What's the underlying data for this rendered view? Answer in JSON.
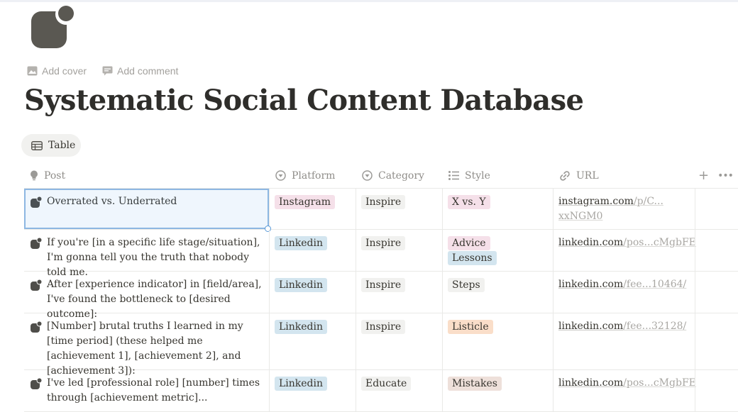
{
  "page": {
    "icon": "app-blob-icon",
    "add_cover": "Add cover",
    "add_comment": "Add comment",
    "title": "Systematic Social Content Database"
  },
  "view": {
    "label": "Table",
    "icon": "table-icon"
  },
  "columns": [
    {
      "label": "Post",
      "icon": "lightbulb-icon"
    },
    {
      "label": "Platform",
      "icon": "select-icon"
    },
    {
      "label": "Category",
      "icon": "select-icon"
    },
    {
      "label": "Style",
      "icon": "list-icon"
    },
    {
      "label": "URL",
      "icon": "link-icon"
    }
  ],
  "colors": {
    "pink_tag": "#f5e0e9",
    "blue_tag": "#d3e5ef",
    "gray_tag": "#f1f1ef",
    "orange_tag": "#fadec9",
    "brown_tag": "#eee0da"
  },
  "rows": [
    {
      "post": "Overrated vs. Underrated",
      "platform": "Instagram",
      "category": "Inspire",
      "styles": [
        "X vs. Y"
      ],
      "url_domain": "instagram.com",
      "url_rest": "/p/C...",
      "url_rest2": "xxNGM0"
    },
    {
      "post": "If you're [in a specific life stage/situation], I'm gonna tell you the truth that nobody told me.",
      "platform": "Linkedin",
      "category": "Inspire",
      "styles": [
        "Advice",
        "Lessons"
      ],
      "url_domain": "linkedin.com",
      "url_rest": "/pos...cMgbFE"
    },
    {
      "post": "After [experience indicator] in [field/area], I've found the bottleneck to [desired outcome]:",
      "platform": "Linkedin",
      "category": "Inspire",
      "styles": [
        "Steps"
      ],
      "url_domain": "linkedin.com",
      "url_rest": "/fee...10464/"
    },
    {
      "post": "[Number] brutal truths I learned in my [time period] (these helped me [achievement 1], [achievement 2], and [achievement 3]):",
      "platform": "Linkedin",
      "category": "Inspire",
      "styles": [
        "Listicle"
      ],
      "url_domain": "linkedin.com",
      "url_rest": "/fee...32128/"
    },
    {
      "post": "I've led [professional role] [number] times through [achievement metric]...",
      "platform": "Linkedin",
      "category": "Educate",
      "styles": [
        "Mistakes"
      ],
      "url_domain": "linkedin.com",
      "url_rest": "/pos...cMgbFE"
    }
  ]
}
